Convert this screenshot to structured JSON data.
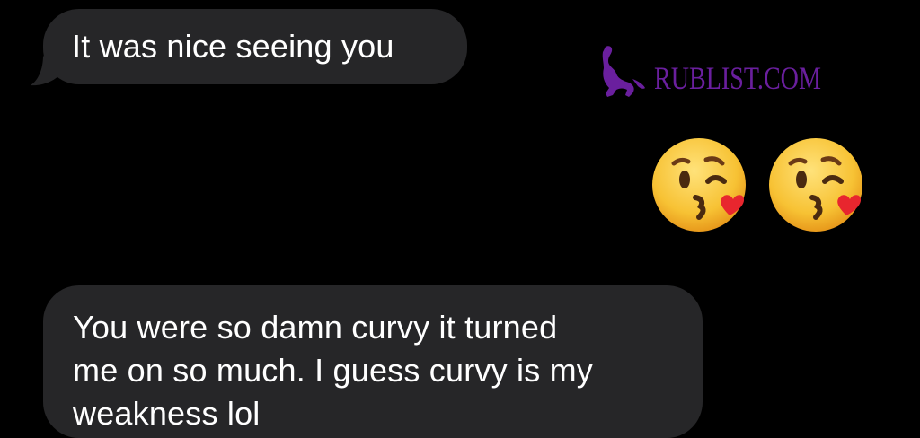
{
  "messages": [
    {
      "direction": "incoming",
      "text": "It was nice seeing you"
    },
    {
      "direction": "outgoing",
      "content_type": "emoji",
      "emojis": [
        "face-blowing-a-kiss",
        "face-blowing-a-kiss"
      ]
    },
    {
      "direction": "incoming",
      "text": "You were so damn curvy it turned\nme on so much. I guess curvy is my\nweakness lol"
    }
  ],
  "watermark": {
    "text": "RUBLIST.COM",
    "color": "#6a1f9e"
  },
  "colors": {
    "background": "#000000",
    "incoming_bubble": "#262628",
    "text": "#ffffff",
    "emoji_face": "#f7c234",
    "emoji_heart": "#e8262e"
  }
}
